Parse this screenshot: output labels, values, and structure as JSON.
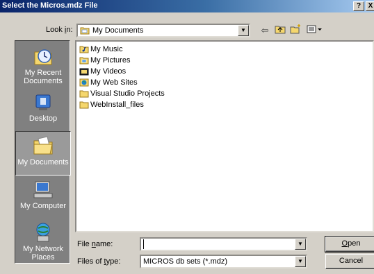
{
  "window": {
    "title": "Select the Micros.mdz File",
    "help_label": "?",
    "close_label": "X"
  },
  "lookin": {
    "label_pre": "Look ",
    "label_ul": "i",
    "label_post": "n:",
    "value": "My Documents"
  },
  "toolbar": {
    "back_icon": "back-arrow-icon",
    "up_icon": "up-folder-icon",
    "new_folder_icon": "new-folder-icon",
    "views_icon": "views-menu-icon"
  },
  "places": [
    {
      "label": "My Recent Documents",
      "icon": "recent-documents-icon"
    },
    {
      "label": "Desktop",
      "icon": "desktop-icon"
    },
    {
      "label": "My Documents",
      "icon": "my-documents-icon",
      "selected": true
    },
    {
      "label": "My Computer",
      "icon": "my-computer-icon"
    },
    {
      "label": "My Network Places",
      "icon": "network-places-icon"
    }
  ],
  "files": [
    {
      "name": "My Music",
      "icon": "music-folder-icon"
    },
    {
      "name": "My Pictures",
      "icon": "pictures-folder-icon"
    },
    {
      "name": "My Videos",
      "icon": "videos-folder-icon"
    },
    {
      "name": "My Web Sites",
      "icon": "web-sites-folder-icon"
    },
    {
      "name": "Visual Studio Projects",
      "icon": "folder-icon"
    },
    {
      "name": "WebInstall_files",
      "icon": "folder-icon"
    }
  ],
  "filename": {
    "label_pre": "File ",
    "label_ul": "n",
    "label_post": "ame:",
    "value": ""
  },
  "filetype": {
    "label_pre": "Files of ",
    "label_ul": "t",
    "label_post": "ype:",
    "value": "MICROS db sets (*.mdz)"
  },
  "buttons": {
    "open_ul": "O",
    "open_rest": "pen",
    "cancel": "Cancel"
  },
  "colors": {
    "title_start": "#0a246a",
    "title_end": "#a6caf0",
    "dialog_bg": "#d4d0c8",
    "places_bg": "#808080",
    "folder": "#f5d76e"
  }
}
